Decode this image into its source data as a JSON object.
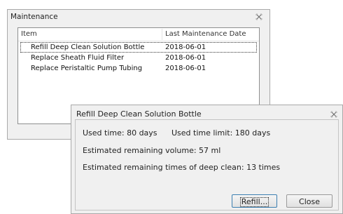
{
  "maintenance_window": {
    "title": "Maintenance",
    "close_icon": "close-icon",
    "columns": [
      "Item",
      "Last Maintenance Date"
    ],
    "rows": [
      {
        "item": "Refill Deep Clean Solution Bottle",
        "date": "2018-06-01"
      },
      {
        "item": "Replace Sheath Fluid Filter",
        "date": "2018-06-01"
      },
      {
        "item": "Replace Peristaltic Pump Tubing",
        "date": "2018-06-01"
      }
    ]
  },
  "refill_dialog": {
    "title": "Refill Deep Clean Solution Bottle",
    "close_icon": "close-icon",
    "used_time": "Used time: 80 days",
    "used_time_limit": "Used time limit: 180 days",
    "remaining_volume": "Estimated remaining volume: 57 ml",
    "remaining_times": "Estimated remaining times of deep clean: 13 times",
    "refill_button": "Refill...",
    "close_button": "Close"
  }
}
